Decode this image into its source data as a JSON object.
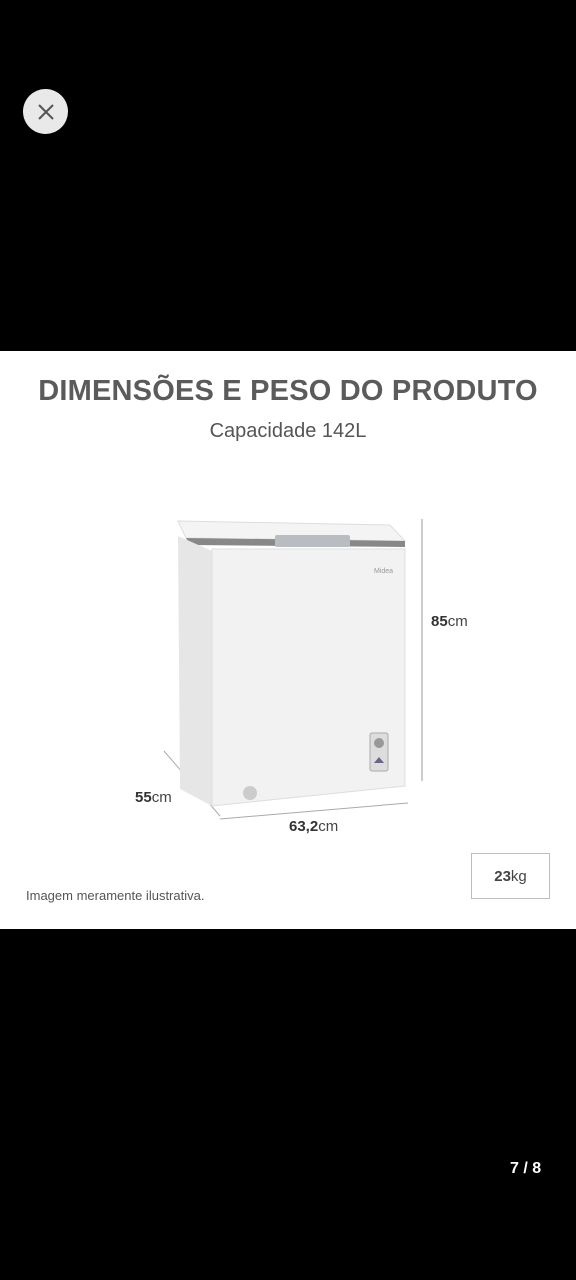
{
  "viewer": {
    "close_icon": "close-icon",
    "page_counter": "7 / 8"
  },
  "product_image": {
    "headline": "DIMENSÕES E PESO DO PRODUTO",
    "subheadline": "Capacidade 142L",
    "brand_logo_text": "Midea",
    "height": {
      "value": "85",
      "unit": "cm"
    },
    "depth": {
      "value": "55",
      "unit": "cm"
    },
    "width": {
      "value": "63,2",
      "unit": "cm"
    },
    "weight": {
      "value": "23",
      "unit": "kg"
    },
    "disclaimer": "Imagem meramente ilustrativa."
  }
}
